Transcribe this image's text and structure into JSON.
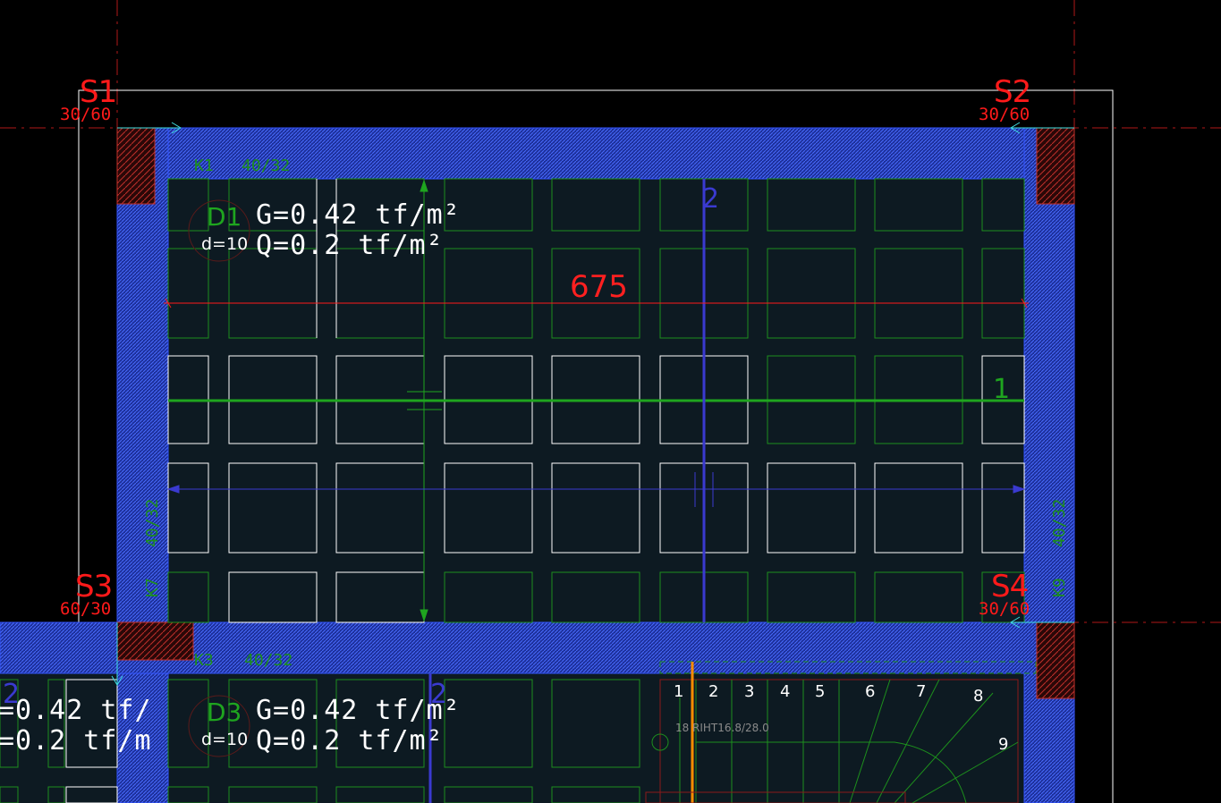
{
  "columns": [
    {
      "name": "S1",
      "size": "30/60"
    },
    {
      "name": "S2",
      "size": "30/60"
    },
    {
      "name": "S3",
      "size": "60/30"
    },
    {
      "name": "S4",
      "size": "30/60"
    }
  ],
  "beams": {
    "k1": {
      "name": "K1",
      "size": "40/32"
    },
    "k3": {
      "name": "K3",
      "size": "40/32"
    },
    "k7": {
      "name": "K7",
      "size": "40/32"
    },
    "k9": {
      "name": "K9",
      "size": "40/32"
    }
  },
  "slabs": {
    "d1": {
      "name": "D1",
      "thickness": "d=10",
      "g_load": "G=0.42 tf/m²",
      "q_load": "Q=0.2 tf/m²"
    },
    "d3": {
      "name": "D3",
      "thickness": "d=10",
      "g_load": "G=0.42 tf/m²",
      "q_load": "Q=0.2 tf/m²"
    },
    "left_partial": {
      "g_load": "=0.42 tf/",
      "q_load": "=0.2 tf/m"
    }
  },
  "dimension": "675",
  "axes": {
    "blue_top": "2",
    "green": "1",
    "blue_left": "2",
    "blue_mid": "2"
  },
  "stair": {
    "steps": [
      "1",
      "2",
      "3",
      "4",
      "5",
      "6",
      "7",
      "8",
      "9"
    ],
    "label_count": "18",
    "label_text": "RIHT16.8/28.0"
  },
  "colors": {
    "background": "#000000",
    "slab_fill": "#0d1a22",
    "beam_hatch": "#2a4fd0",
    "grid_green": "#1d8f1d",
    "dimension_red": "#ff1a1a",
    "axis_blue": "#3a3ad0"
  }
}
